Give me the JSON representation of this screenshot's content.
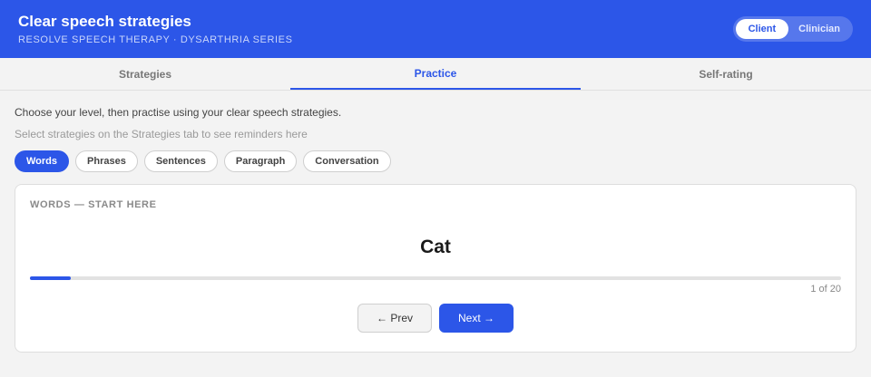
{
  "header": {
    "title": "Clear speech strategies",
    "subtitle": "Resolve Speech Therapy · Dysarthria series",
    "modes": [
      {
        "label": "Client",
        "active": true
      },
      {
        "label": "Clinician",
        "active": false
      }
    ]
  },
  "tabs": [
    {
      "label": "Strategies",
      "active": false
    },
    {
      "label": "Practice",
      "active": true
    },
    {
      "label": "Self-rating",
      "active": false
    }
  ],
  "practice": {
    "instruction": "Choose your level, then practise using your clear speech strategies.",
    "hint": "Select strategies on the Strategies tab to see reminders here",
    "levels": [
      {
        "label": "Words",
        "active": true
      },
      {
        "label": "Phrases",
        "active": false
      },
      {
        "label": "Sentences",
        "active": false
      },
      {
        "label": "Paragraph",
        "active": false
      },
      {
        "label": "Conversation",
        "active": false
      }
    ],
    "card": {
      "label": "WORDS — START HERE",
      "word": "Cat",
      "progress": {
        "current": 1,
        "total": 20,
        "text": "1 of 20"
      },
      "prev_label": "← Prev",
      "next_label": "Next →"
    }
  },
  "colors": {
    "accent": "#2c56e8",
    "background": "#f3f3f3",
    "card": "#ffffff"
  }
}
